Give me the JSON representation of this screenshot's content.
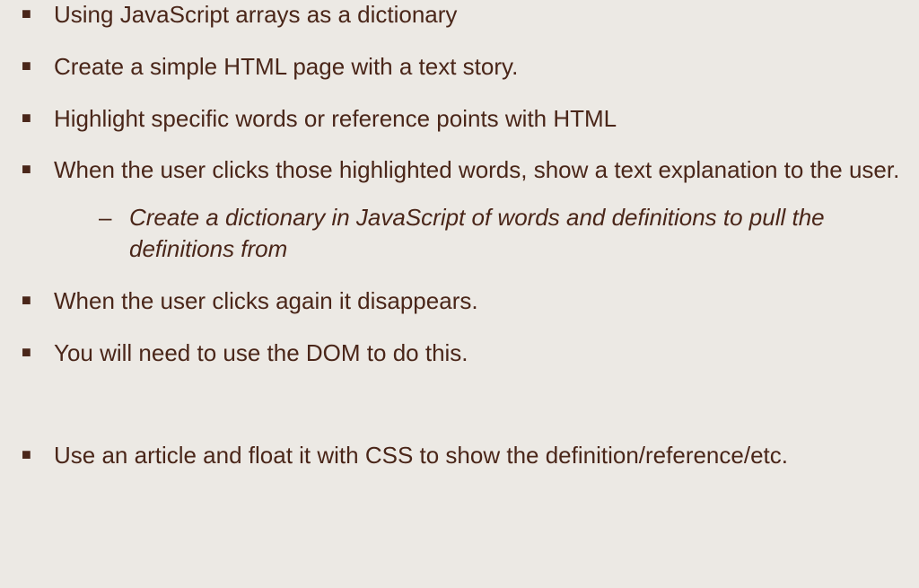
{
  "bullets": [
    {
      "text": "Using JavaScript arrays as a dictionary"
    },
    {
      "text": "Create a simple HTML page with a text story."
    },
    {
      "text": "Highlight specific words or reference points with HTML"
    },
    {
      "text": "When the user clicks those highlighted words, show a text explanation to the user.",
      "sub": [
        {
          "text": "Create a dictionary in JavaScript of words and definitions to pull the definitions from"
        }
      ]
    },
    {
      "text": "When the user clicks again it disappears."
    },
    {
      "text": "You will need to use the DOM to do this."
    },
    {
      "text": "Use an article and float it with CSS to show the definition/reference/etc.",
      "spaced": true
    }
  ]
}
